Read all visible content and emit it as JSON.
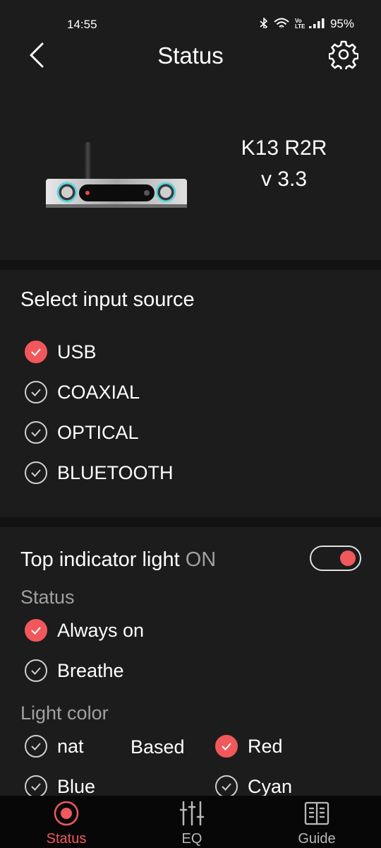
{
  "status_bar": {
    "time": "14:55",
    "network": "Vo LTE",
    "battery": "95%"
  },
  "header": {
    "title": "Status",
    "back_icon": "chevron-left-icon",
    "settings_icon": "gear-icon"
  },
  "device": {
    "model": "K13 R2R",
    "version": "v 3.3"
  },
  "input_source": {
    "title": "Select input source",
    "options": [
      {
        "label": "USB",
        "selected": true
      },
      {
        "label": "COAXIAL",
        "selected": false
      },
      {
        "label": "OPTICAL",
        "selected": false
      },
      {
        "label": "BLUETOOTH",
        "selected": false
      }
    ]
  },
  "indicator": {
    "title": "Top indicator light",
    "state": "ON",
    "toggle_on": true,
    "status_label": "Status",
    "status_options": [
      {
        "label": "Always on",
        "selected": true
      },
      {
        "label": "Breathe",
        "selected": false
      }
    ],
    "color_label": "Light color",
    "color_options": [
      {
        "label": "nat",
        "selected": false
      },
      {
        "label": "Red",
        "selected": true
      },
      {
        "label": "Blue",
        "selected": false
      },
      {
        "label": "Cyan",
        "selected": false
      }
    ],
    "based_text": "Based"
  },
  "colors": {
    "accent": "#f0585c",
    "background": "#121212",
    "card": "#1c1c1c"
  },
  "bottom_nav": [
    {
      "label": "Status",
      "icon": "record-icon",
      "active": true
    },
    {
      "label": "EQ",
      "icon": "equalizer-sliders-icon",
      "active": false
    },
    {
      "label": "Guide",
      "icon": "book-icon",
      "active": false
    }
  ]
}
